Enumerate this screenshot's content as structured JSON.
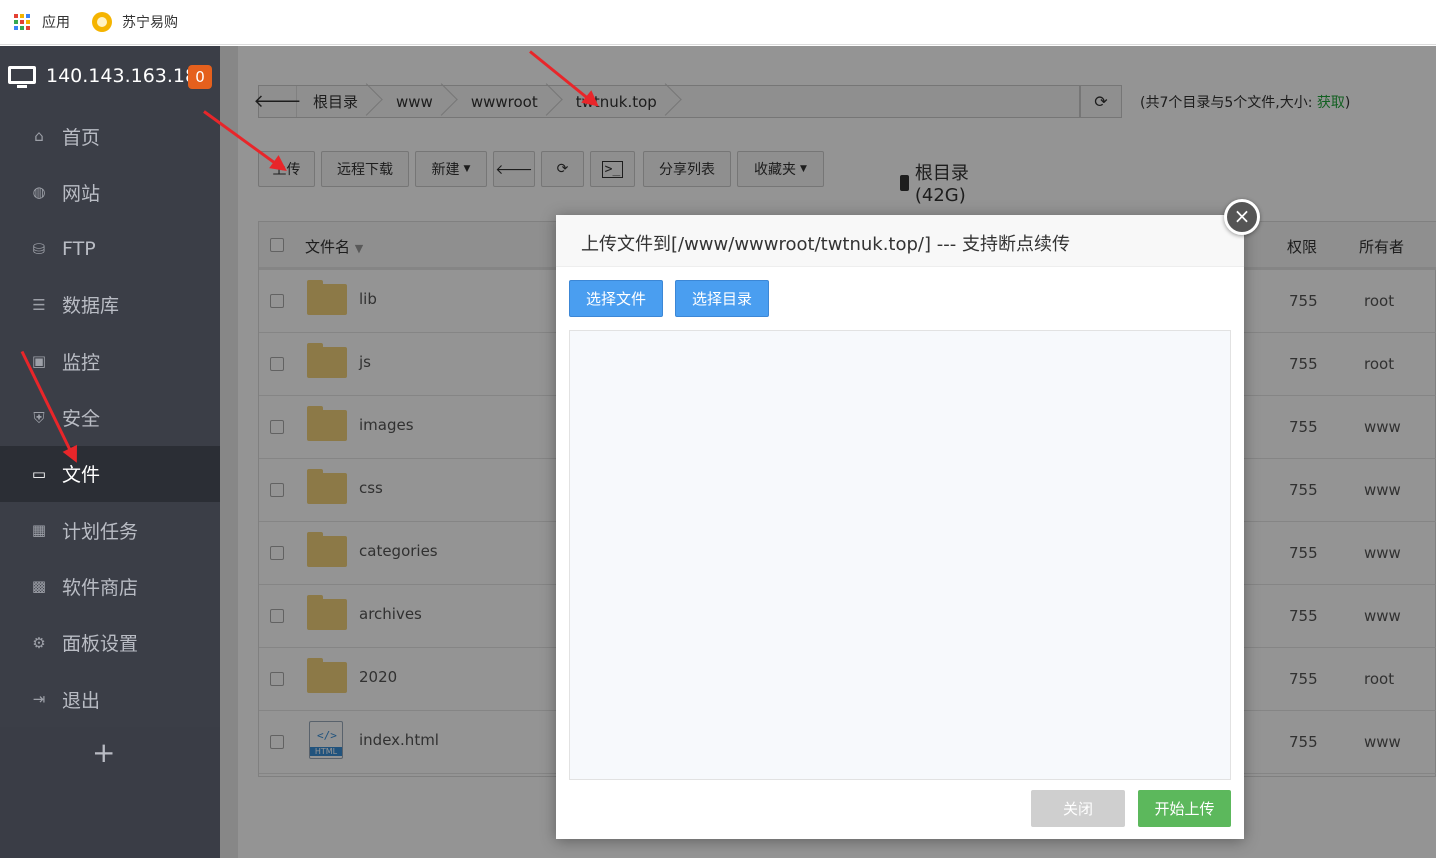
{
  "bookmarks": {
    "apps_label": "应用",
    "suning_label": "苏宁易购",
    "apps_colors": [
      "#e44134",
      "#f4b400",
      "#3a82f6",
      "#34a853",
      "#e44134",
      "#f4b400",
      "#3a82f6",
      "#34a853",
      "#e44134"
    ]
  },
  "server": {
    "ip": "140.143.163.183",
    "badge": "0"
  },
  "nav": [
    {
      "label": "首页",
      "icon": "home-icon",
      "glyph": "⌂"
    },
    {
      "label": "网站",
      "icon": "globe-icon",
      "glyph": "◍"
    },
    {
      "label": "FTP",
      "icon": "ftp-icon",
      "glyph": "⛁"
    },
    {
      "label": "数据库",
      "icon": "database-icon",
      "glyph": "☰"
    },
    {
      "label": "监控",
      "icon": "monitor-icon",
      "glyph": "▣"
    },
    {
      "label": "安全",
      "icon": "shield-icon",
      "glyph": "⛨"
    },
    {
      "label": "文件",
      "icon": "folder-icon",
      "glyph": "▭"
    },
    {
      "label": "计划任务",
      "icon": "calendar-icon",
      "glyph": "▦"
    },
    {
      "label": "软件商店",
      "icon": "apps-icon",
      "glyph": "▩"
    },
    {
      "label": "面板设置",
      "icon": "gear-icon",
      "glyph": "⚙"
    },
    {
      "label": "退出",
      "icon": "logout-icon",
      "glyph": "⇥"
    }
  ],
  "nav_active": "文件",
  "nav_add": "+",
  "path": {
    "crumbs": [
      "根目录",
      "www",
      "wwwroot",
      "twtnuk.top"
    ],
    "info_prefix": "(共7个目录与5个文件,大小: ",
    "info_link": "获取",
    "info_suffix": ")"
  },
  "toolbar": {
    "upload": "上传",
    "remote_download": "远程下载",
    "new": "新建",
    "share_list": "分享列表",
    "favorites": "收藏夹",
    "disk": "根目录(42G)"
  },
  "table": {
    "col_name": "文件名",
    "col_perm": "权限",
    "col_owner": "所有者",
    "rows": [
      {
        "name": "lib",
        "perm": "755",
        "owner": "root",
        "type": "folder"
      },
      {
        "name": "js",
        "perm": "755",
        "owner": "root",
        "type": "folder"
      },
      {
        "name": "images",
        "perm": "755",
        "owner": "www",
        "type": "folder"
      },
      {
        "name": "css",
        "perm": "755",
        "owner": "www",
        "type": "folder"
      },
      {
        "name": "categories",
        "perm": "755",
        "owner": "www",
        "type": "folder"
      },
      {
        "name": "archives",
        "perm": "755",
        "owner": "www",
        "type": "folder"
      },
      {
        "name": "2020",
        "perm": "755",
        "owner": "root",
        "type": "folder"
      },
      {
        "name": "index.html",
        "perm": "755",
        "owner": "www",
        "type": "html"
      }
    ]
  },
  "dialog": {
    "title": "上传文件到[/www/wwwroot/twtnuk.top/] --- 支持断点续传",
    "select_files": "选择文件",
    "select_dir": "选择目录",
    "close": "关闭",
    "start_upload": "开始上传",
    "close_icon": "×",
    "html_icon_tag": "</>",
    "html_icon_label": "HTML"
  }
}
